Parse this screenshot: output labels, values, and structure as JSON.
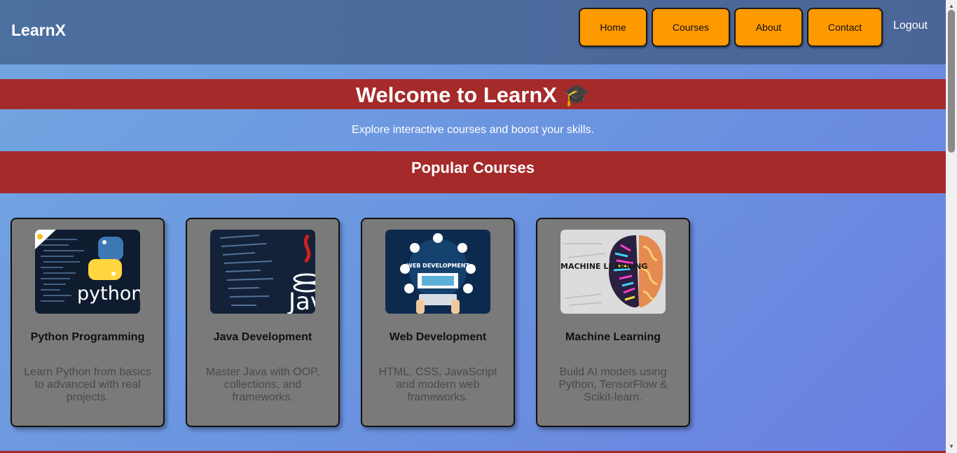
{
  "nav": {
    "brand": "LearnX",
    "links": [
      "Home",
      "Courses",
      "About",
      "Contact"
    ],
    "logout": "Logout"
  },
  "hero": {
    "title": "Welcome to LearnX 🎓",
    "subtitle": "Explore interactive courses and boost your skills."
  },
  "section": {
    "title": "Popular Courses"
  },
  "courses": [
    {
      "title": "Python Programming",
      "description": "Learn Python from basics to advanced with real projects.",
      "image_text": "python"
    },
    {
      "title": "Java Development",
      "description": "Master Java with OOP, collections, and frameworks.",
      "image_text": "Jav"
    },
    {
      "title": "Web Development",
      "description": "HTML, CSS, JavaScript and modern web frameworks.",
      "image_text": "WEB DEVELOPMENT"
    },
    {
      "title": "Machine Learning",
      "description": "Build AI models using Python, TensorFlow & Scikit-learn.",
      "image_text": "MACHINE LEARNING"
    }
  ],
  "colors": {
    "nav_button": "#ff9900",
    "banner": "#a52a2a",
    "card": "#7a7a7a"
  }
}
